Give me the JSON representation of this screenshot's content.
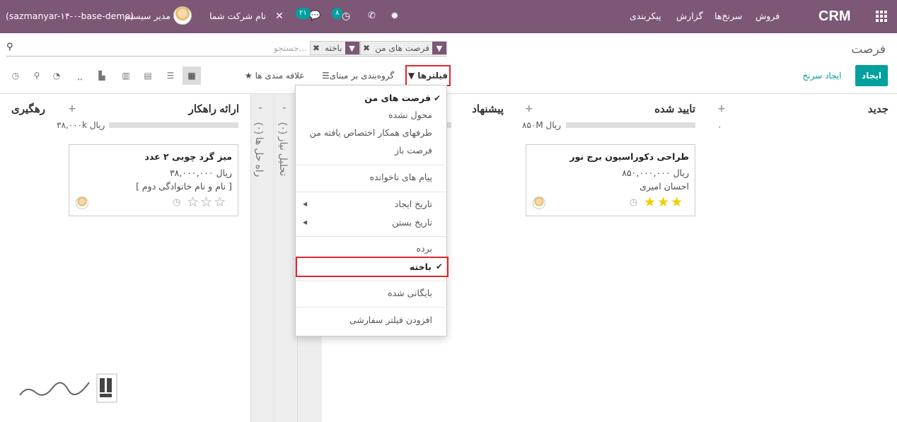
{
  "nav": {
    "brand": "CRM",
    "menu": [
      "فروش",
      "سرنخ‌ها",
      "گزارش",
      "پیکربندی"
    ],
    "messages_badge": "۲۱",
    "activities_badge": "۸",
    "company": "نام شرکت شما",
    "user": "مدیر سیستم",
    "db": "(sazmanyar-۱۴-۰-base-demo)"
  },
  "page": {
    "title": "فرصت",
    "create_button": "ایجاد",
    "create_lead_button": "ایجاد سرنخ"
  },
  "search": {
    "placeholder": "جستجو...",
    "facets": [
      "فرصت های من",
      "باخته"
    ]
  },
  "controls": {
    "filters": "فیلترها",
    "group_by": "گروه‌بندی بر مبنای",
    "favorites": "علاقه مندی ها"
  },
  "columns": [
    {
      "title": "جدید",
      "count": "۰"
    },
    {
      "title": "تایید شده",
      "summary": "۸۵۰M ریال"
    },
    {
      "title": "پیشنهاد"
    },
    {
      "title": "ارائه راهکار",
      "summary": "۳۸,۰۰۰k ریال"
    },
    {
      "title": "رهگیری"
    }
  ],
  "folded": [
    {
      "title": "تحلیل نیاز (۰)"
    },
    {
      "title": "راه حل ها (۰)"
    }
  ],
  "cards": [
    {
      "title": "طراحی دکوراسیون برج نور",
      "amount": "۸۵۰,۰۰۰,۰۰۰ ریال",
      "contact": "احسان امیری",
      "stars_filled": 3,
      "stars_total": 3
    },
    {
      "title": "میز گرد چوبی ۲ عدد",
      "amount": "۳۸,۰۰۰,۰۰۰ ریال",
      "contact": "[ نام و نام خانوادگی دوم ]",
      "stars_filled": 0,
      "stars_total": 3
    }
  ],
  "dropdown": {
    "items": [
      {
        "label": "فرصت های من",
        "checked": true
      },
      {
        "label": "محول نشده"
      },
      {
        "label": "طرفهای همکار اختصاص یافته من"
      },
      {
        "label": "فرصت باز"
      },
      {
        "label": "پیام های ناخوانده"
      },
      {
        "label": "تاریخ ایجاد",
        "submenu": true
      },
      {
        "label": "تاریخ بستن",
        "submenu": true
      },
      {
        "label": "برده"
      },
      {
        "label": "باخته",
        "checked": true
      },
      {
        "label": "بایگانی شده"
      },
      {
        "label": "افزودن فیلتر سفارشی"
      }
    ]
  },
  "colors": {
    "nav": "#7c5776",
    "accent": "#00a09d",
    "highlight": "#e3252b",
    "star": "#f3cc00"
  }
}
